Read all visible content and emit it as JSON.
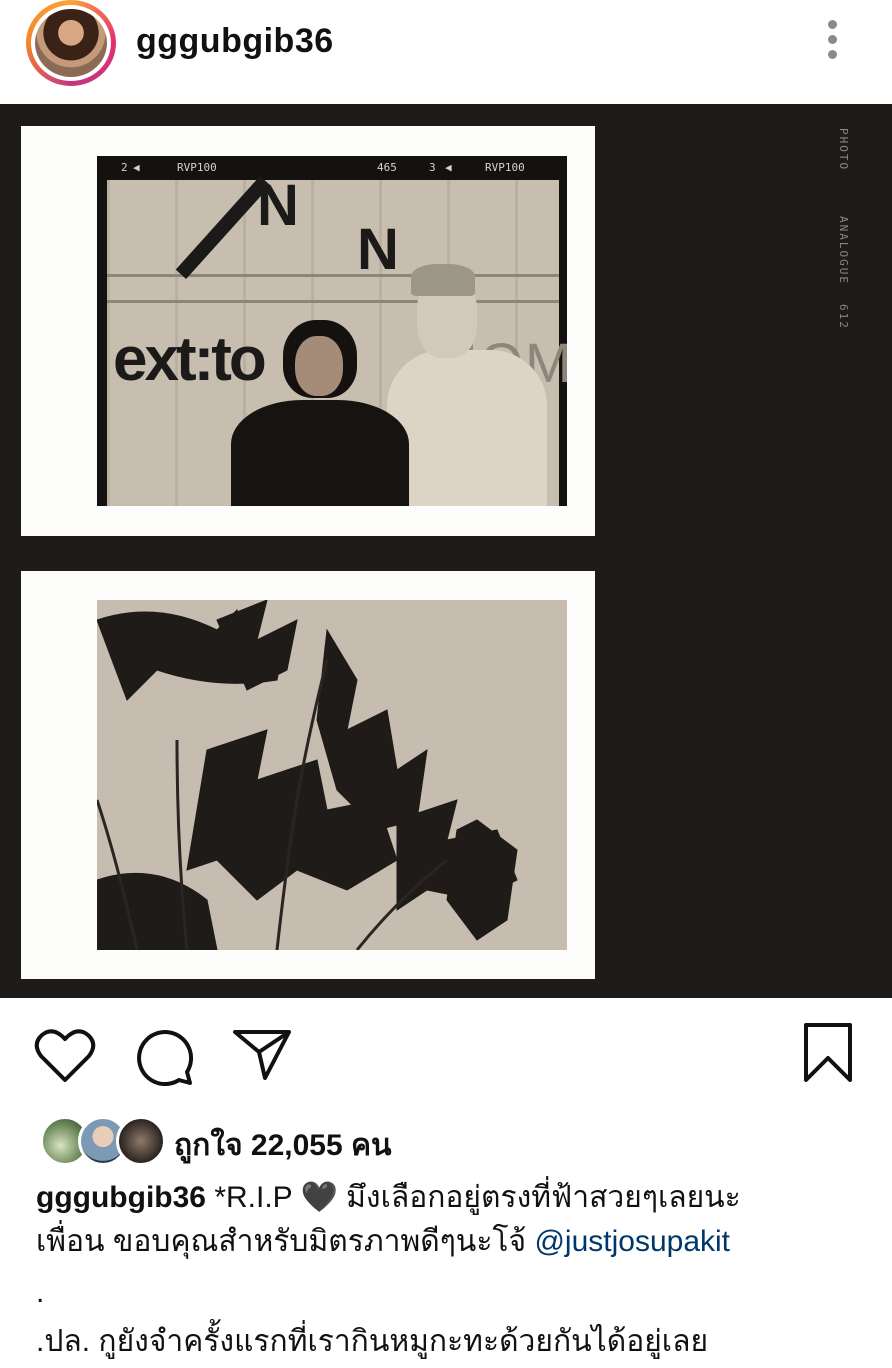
{
  "header": {
    "username": "gggubgib36",
    "avatar_icon": "profile-avatar",
    "more_icon": "more-vertical-icon"
  },
  "post": {
    "side_text_top": "PHOTO",
    "side_text_mid": "ANALOGUE",
    "side_text_num": "612",
    "film_labels": {
      "frame_a": "2",
      "brand_a": "RVP100",
      "number": "465",
      "frame_b": "3",
      "brand_b": "RVP100"
    },
    "sign_text": {
      "n1": "N",
      "n2": "N",
      "ext": "ext:to",
      "right": "NOMA"
    }
  },
  "actions": {
    "like_icon": "heart-icon",
    "comment_icon": "comment-icon",
    "share_icon": "share-icon",
    "save_icon": "bookmark-icon"
  },
  "likes": {
    "text": "ถูกใจ 22,055 คน"
  },
  "caption": {
    "username": "gggubgib36",
    "text_1": " *R.I.P 🖤 มึงเลือกอยู่ตรงที่ฟ้าสวยๆเลยนะ",
    "text_2": "เพื่อน ขอบคุณสำหรับมิตรภาพดีๆนะโจ้ ",
    "mention": "@justjosupakit",
    "dot": ".",
    "text_3": ".ปล. กูยังจำครั้งแรกที่เรากินหมูกะทะด้วยกันได้อยู่เลย"
  }
}
